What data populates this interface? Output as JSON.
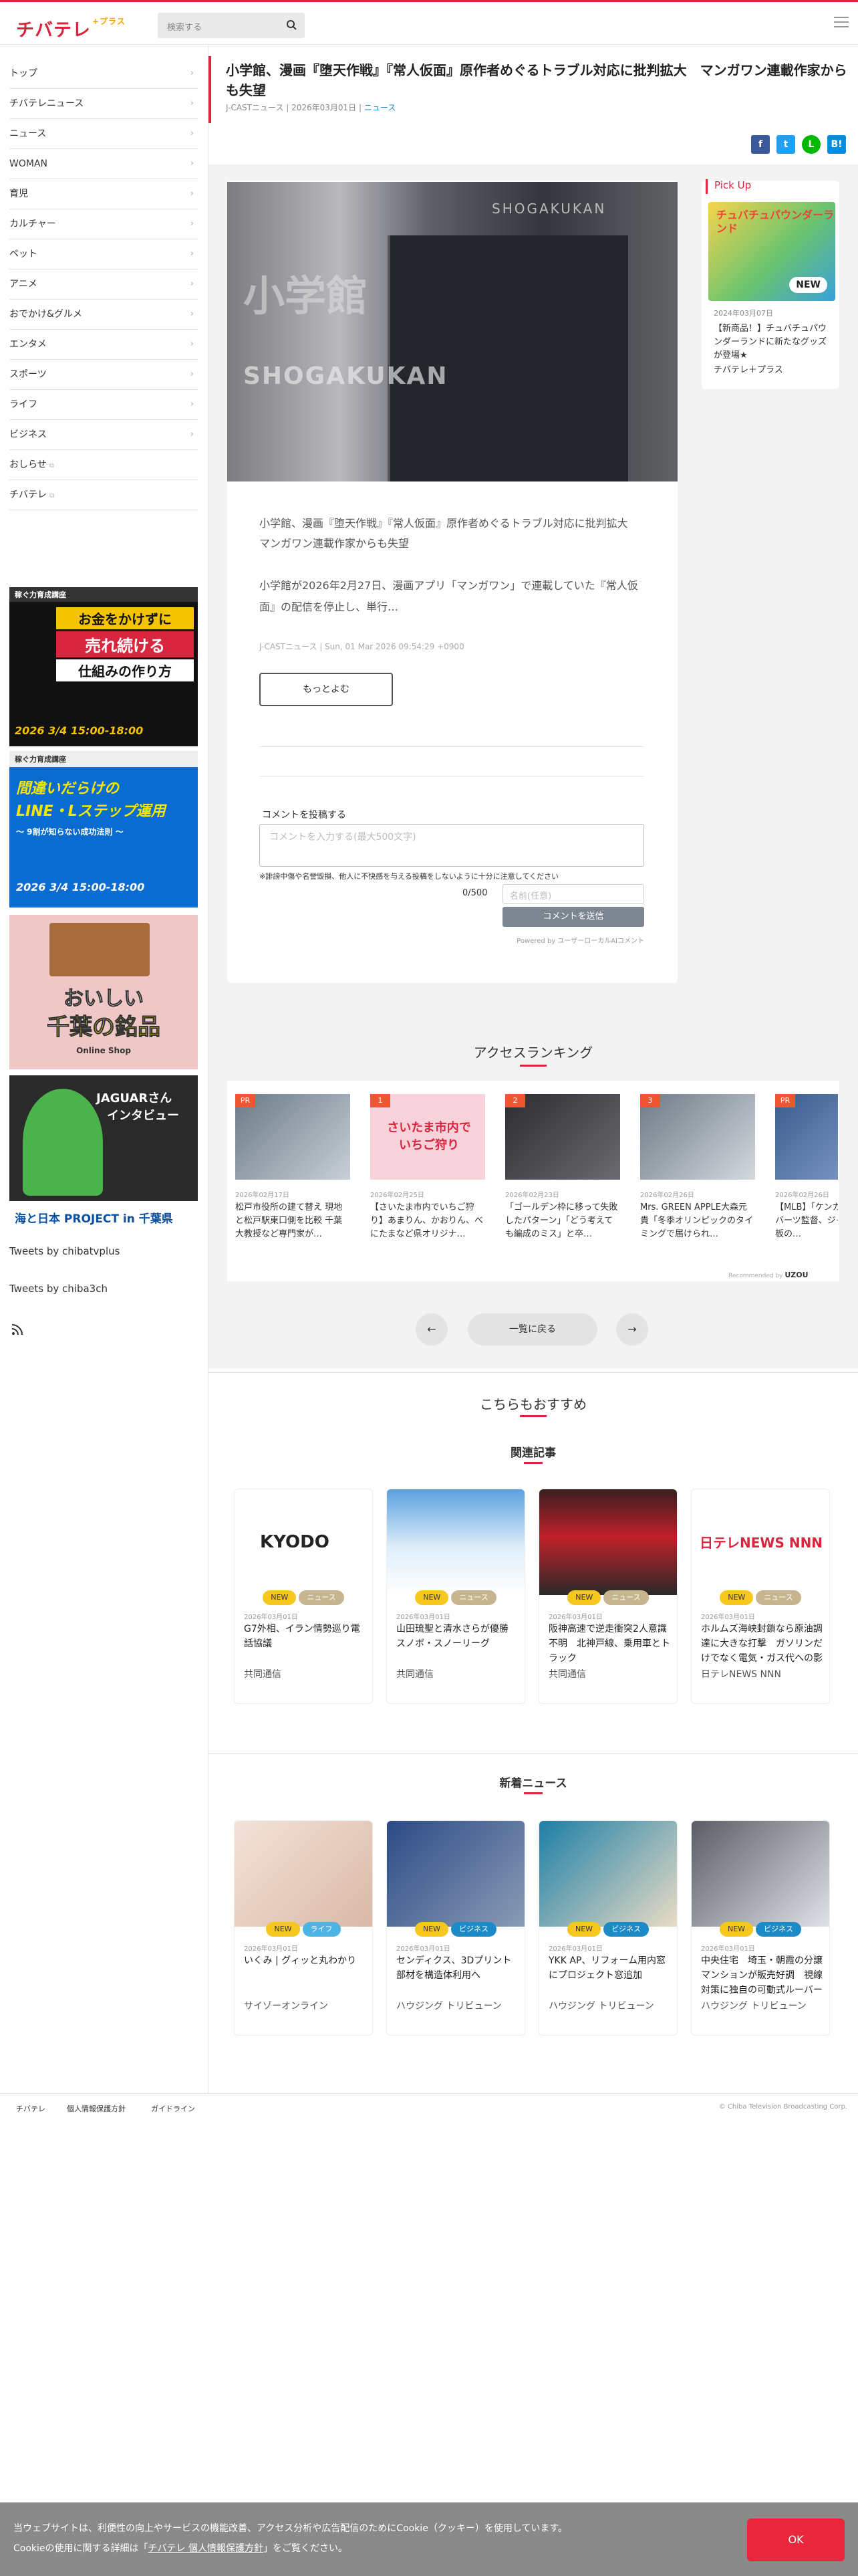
{
  "header": {
    "logo_main": "チバテレ",
    "logo_plus": "+プラス",
    "search_placeholder": "検索する"
  },
  "sidebar": {
    "items": [
      {
        "label": "トップ"
      },
      {
        "label": "チバテレニュース"
      },
      {
        "label": "ニュース"
      },
      {
        "label": "WOMAN"
      },
      {
        "label": "育児"
      },
      {
        "label": "カルチャー"
      },
      {
        "label": "ペット"
      },
      {
        "label": "アニメ"
      },
      {
        "label": "おでかけ&グルメ"
      },
      {
        "label": "エンタメ"
      },
      {
        "label": "スポーツ"
      },
      {
        "label": "ライフ"
      },
      {
        "label": "ビジネス"
      },
      {
        "label": "おしらせ"
      },
      {
        "label": "チバテレ"
      }
    ],
    "banners": {
      "b1_top": "稼ぐ力育成講座",
      "b1_main1": "お金をかけずに",
      "b1_main2": "売れ続ける",
      "b1_main3": "仕組みの作り方",
      "b1_date": "2026 3/4 15:00-18:00",
      "b2_top": "稼ぐ力育成講座",
      "b2_main1": "間違いだらけの",
      "b2_main2": "LINE・Lステップ運用",
      "b2_sub": "〜 9割が知らない成功法則 〜",
      "b2_date": "2026 3/4 15:00-18:00",
      "b3_main1": "おいしい",
      "b3_main2": "千葉の銘品",
      "b3_sub": "Online Shop",
      "b4_main1": "JAGUARさん",
      "b4_main2": "インタビュー",
      "b4_bottom": "海と日本 PROJECT in 千葉県"
    },
    "tweets1": "Tweets by chibatvplus",
    "tweets2": "Tweets by chiba3ch"
  },
  "article": {
    "title": "小学館、漫画『堕天作戦』『常人仮面』原作者めぐるトラブル対応に批判拡大　マンガワン連載作家からも失望",
    "source": "J-CASTニュース",
    "date": "2026年03月01日",
    "category": "ニュース",
    "hero_text1": "小学館",
    "hero_text2": "SHOGAKUKAN",
    "hero_text3": "SHOGAKUKAN",
    "lead_title": "小学館、漫画『堕天作戦』『常人仮面』原作者めぐるトラブル対応に批判拡大　マンガワン連載作家からも失望",
    "lead_body": "小学館が2026年2月27日、漫画アプリ「マンガワン」で連載していた『常人仮面』の配信を停止し、単行…",
    "lead_date": "J-CASTニュース | Sun, 01 Mar 2026 09:54:29 +0900",
    "more_label": "もっとよむ"
  },
  "comment": {
    "label": "コメントを投稿する",
    "placeholder": "コメントを入力する(最大500文字)",
    "note": "※誹謗中傷や名誉毀損、他人に不快感を与える投稿をしないように十分に注意してください",
    "count": "0/500",
    "name_placeholder": "名前(任意)",
    "submit": "コメントを送信",
    "powered": "Powered by ユーザーローカルAIコメント"
  },
  "pickup": {
    "heading": "Pick Up",
    "img_text": "チュバチュパウンダーランド",
    "img_new": "NEW",
    "date": "2024年03月07日",
    "title": "【新商品！】チュバチュパウンダーランドに新たなグッズが登場★",
    "source": "チバテレ＋プラス"
  },
  "ranking": {
    "heading": "アクセスランキング",
    "items": [
      {
        "badge": "PR",
        "date": "2026年02月17日",
        "title": "松戸市役所の建て替え 現地と松戸駅東口側を比較 千葉大教授など専門家が…",
        "img_text": ""
      },
      {
        "badge": "1",
        "date": "2026年02月25日",
        "title": "【さいたま市内でいちご狩り】あまりん、かおりん、べにたまなど県オリジナ…",
        "img_text": "さいたま市内で いちご狩り"
      },
      {
        "badge": "2",
        "date": "2026年02月23日",
        "title": "「ゴールデン枠に移って失敗したパターン」「どう考えても編成のミス」と卒…",
        "img_text": ""
      },
      {
        "badge": "3",
        "date": "2026年02月26日",
        "title": "Mrs. GREEN APPLE大森元貴「冬季オリンピックのタイミングで届けられ…",
        "img_text": ""
      },
      {
        "badge": "PR",
        "date": "2026年02月26日",
        "title": "【MLB】「ケンカしてた」ロバーツ監督、ジャッジ戦初登板の…",
        "img_text": ""
      }
    ],
    "powered": "Recommended by",
    "powered_brand": "UZOU"
  },
  "pager": {
    "prev": "←",
    "list": "一覧に戻る",
    "next": "→"
  },
  "recommend": {
    "heading": "こちらもおすすめ",
    "related_heading": "関連記事",
    "related": [
      {
        "img_text": "KYODO",
        "tag1": "NEW",
        "tag2": "ニュース",
        "date": "2026年03月01日",
        "title": "G7外相、イラン情勢巡り電話協議",
        "source": "共同通信"
      },
      {
        "img_text": "",
        "tag1": "NEW",
        "tag2": "ニュース",
        "date": "2026年03月01日",
        "title": "山田琉聖と清水さらが優勝　スノボ・スノーリーグ",
        "source": "共同通信"
      },
      {
        "img_text": "",
        "tag1": "NEW",
        "tag2": "ニュース",
        "date": "2026年03月01日",
        "title": "阪神高速で逆走衝突2人意識不明　北神戸線、乗用車とトラック",
        "source": "共同通信"
      },
      {
        "img_text": "日テレNEWS NNN",
        "tag1": "NEW",
        "tag2": "ニュース",
        "date": "2026年03月01日",
        "title": "ホルムズ海峡封鎖なら原油調達に大きな打撃　ガソリンだけでなく電気・ガス代への影響も",
        "source": "日テレNEWS NNN"
      }
    ],
    "new_heading": "新着ニュース",
    "latest": [
      {
        "tag1": "NEW",
        "tag2": "ライフ",
        "date": "2026年03月01日",
        "title": "いくみ | グィッと丸わかり",
        "source": "サイゾーオンライン"
      },
      {
        "tag1": "NEW",
        "tag2": "ビジネス",
        "date": "2026年03月01日",
        "title": "センディクス、3Dプリント部材を構造体利用へ",
        "source": "ハウジング トリビューン"
      },
      {
        "tag1": "NEW",
        "tag2": "ビジネス",
        "date": "2026年03月01日",
        "title": "YKK AP、リフォーム用内窓にプロジェクト窓追加",
        "source": "ハウジング トリビューン"
      },
      {
        "tag1": "NEW",
        "tag2": "ビジネス",
        "date": "2026年03月01日",
        "title": "中央住宅　埼玉・朝霞の分譲マンションが販売好調　視線対策に独自の可動式ルーバー開発",
        "source": "ハウジング トリビューン"
      }
    ]
  },
  "footer": {
    "link1": "チバテレ",
    "link2": "個人情報保護方針",
    "link3": "ガイドライン",
    "copyright": "© Chiba Television Broadcasting Corp."
  },
  "cookie": {
    "line1": "当ウェブサイトは、利便性の向上やサービスの機能改善、アクセス分析や広告配信のためにCookie（クッキー）を使用しています。",
    "line2_pre": "Cookieの使用に関する詳細は「",
    "line2_link": "チバテレ 個人情報保護方針",
    "line2_post": "」をご覧ください。",
    "ok": "OK"
  },
  "colors": {
    "accent": "#d7263d",
    "link": "#1d8acb",
    "facebook": "#3b5998",
    "twitter": "#1da1f2",
    "line": "#00b900",
    "hatena": "#008fde"
  }
}
